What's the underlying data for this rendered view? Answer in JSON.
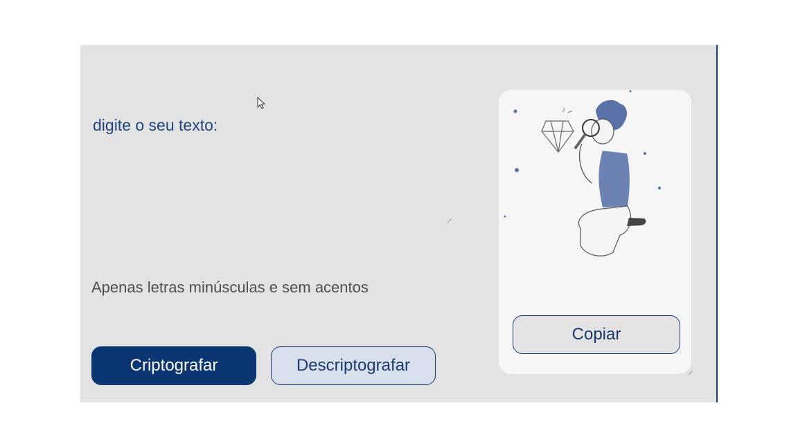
{
  "input": {
    "placeholder": "digite o seu texto:"
  },
  "hint": {
    "text": "Apenas letras minúsculas e sem acentos",
    "icon": "info-icon"
  },
  "buttons": {
    "encrypt_label": "Criptografar",
    "decrypt_label": "Descriptografar",
    "copy_label": "Copiar"
  },
  "colors": {
    "primary": "#0c3672",
    "secondary_bg": "#d7dfeb",
    "panel_bg": "#e3e3e3",
    "card_bg": "#f6f6f6"
  }
}
